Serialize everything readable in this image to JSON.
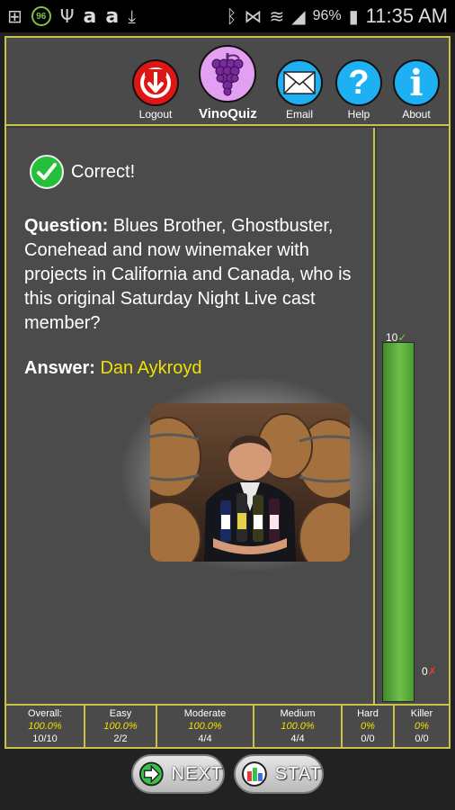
{
  "status_bar": {
    "battery_percent": "96%",
    "time": "11:35 AM",
    "badge": "96"
  },
  "header": {
    "logout_label": "Logout",
    "app_label": "VinoQuiz",
    "email_label": "Email",
    "help_label": "Help",
    "about_label": "About"
  },
  "result": {
    "status": "Correct!",
    "question_prefix": "Question:",
    "question_text": "Blues Brother, Ghostbuster, Conehead and now winemaker with projects in California and Canada, who is this original Saturday Night Live cast member?",
    "answer_prefix": "Answer:",
    "answer_text": "Dan Aykroyd"
  },
  "progress": {
    "correct_label": "10",
    "wrong_label": "0",
    "correct_total": 10,
    "total": 10
  },
  "stats": [
    {
      "name": "Overall:",
      "pct": "100.0%",
      "score": "10/10"
    },
    {
      "name": "Easy",
      "pct": "100.0%",
      "score": "2/2"
    },
    {
      "name": "Moderate",
      "pct": "100.0%",
      "score": "4/4"
    },
    {
      "name": "Medium",
      "pct": "100.0%",
      "score": "4/4"
    },
    {
      "name": "Hard",
      "pct": "0%",
      "score": "0/0"
    },
    {
      "name": "Killer",
      "pct": "0%",
      "score": "0/0"
    }
  ],
  "buttons": {
    "next": "NEXT",
    "stat": "STAT"
  },
  "colors": {
    "accent_border": "#c9c34a",
    "answer": "#f0e000",
    "logout": "#e01616",
    "app_icon": "#e3a0f2",
    "info_icons": "#1db0f2",
    "progress": "#6fc04a"
  }
}
